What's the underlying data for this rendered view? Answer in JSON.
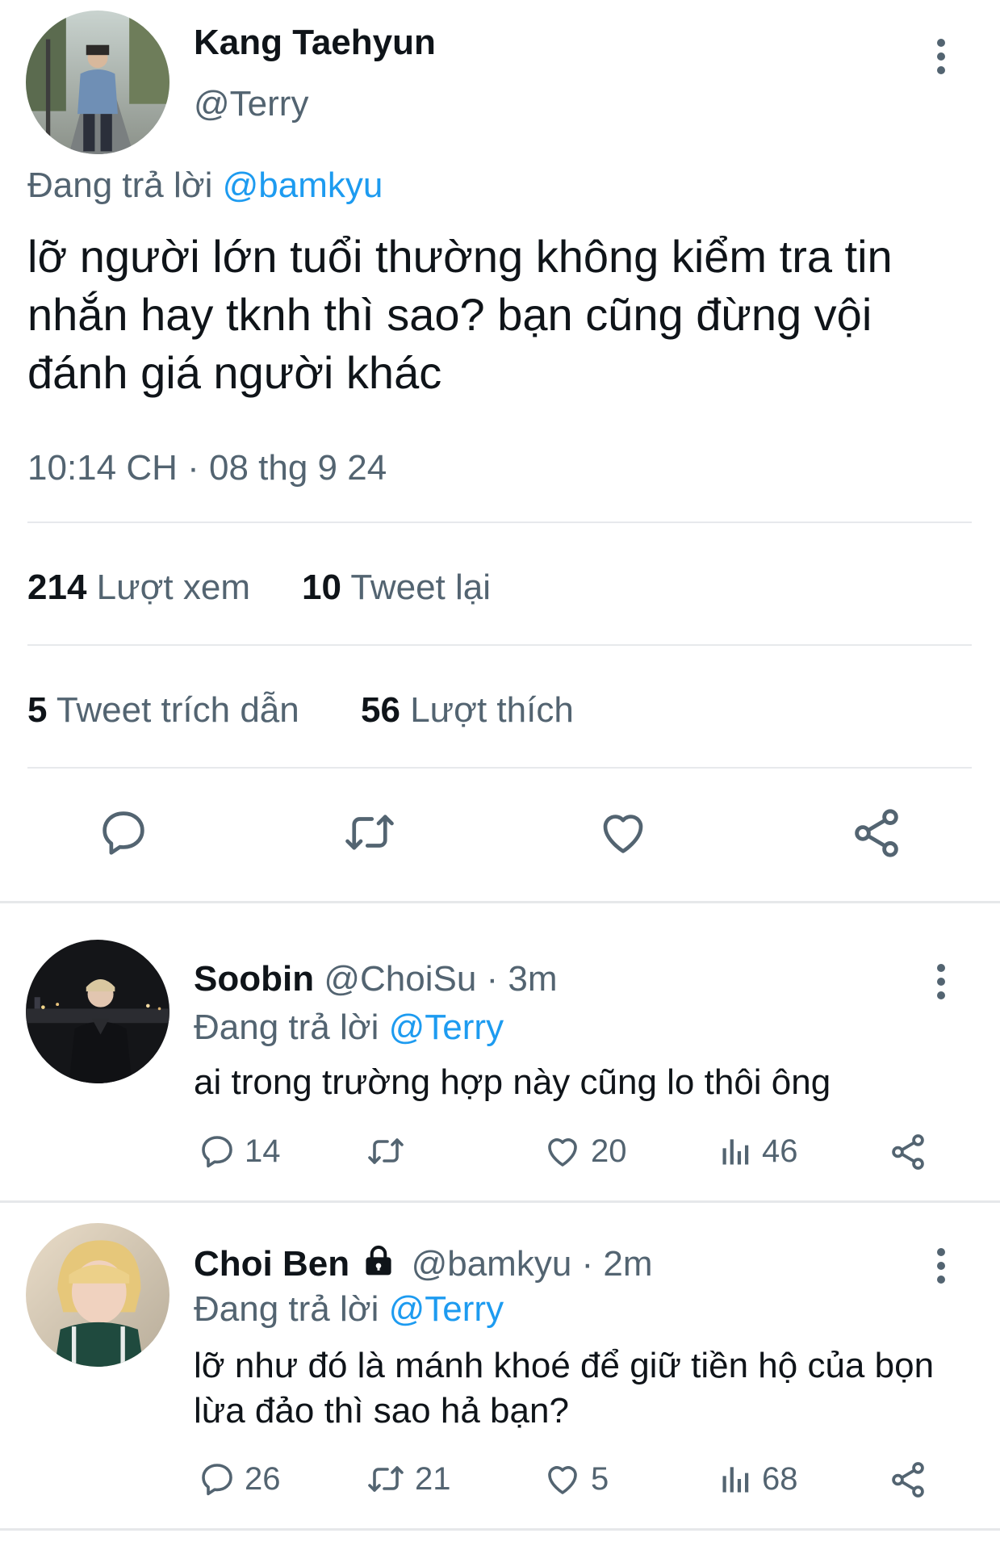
{
  "main_tweet": {
    "author_name": "Kang Taehyun",
    "author_handle": "@Terry",
    "replying_prefix": "Đang trả lời ",
    "replying_to": "@bamkyu",
    "text": "lỡ người lớn tuổi thường không kiểm tra tin\nnhắn hay tknh thì sao? bạn cũng đừng vội\nđánh giá người khác",
    "timestamp": "10:14 CH · 08 thg 9 24",
    "stats": {
      "views_count": "214",
      "views_label": "Lượt xem",
      "retweets_count": "10",
      "retweets_label": "Tweet lại",
      "quotes_count": "5",
      "quotes_label": "Tweet trích dẫn",
      "likes_count": "56",
      "likes_label": "Lượt thích"
    },
    "actions": [
      "reply-icon",
      "retweet-icon",
      "like-icon",
      "share-icon"
    ]
  },
  "replies": [
    {
      "name": "Soobin",
      "handle": "@ChoiSu",
      "time": " · 3m",
      "replying_prefix": "Đang trả lời ",
      "replying_to": "@Terry",
      "text": "ai trong trường hợp này cũng lo thôi ông",
      "locked": false,
      "counts": {
        "replies": "14",
        "retweets": "",
        "likes": "20",
        "views": "46"
      }
    },
    {
      "name": "Choi Ben",
      "handle": "@bamkyu",
      "time": " · 2m",
      "replying_prefix": "Đang trả lời ",
      "replying_to": "@Terry",
      "text": "lỡ như đó là mánh khoé để giữ tiền hộ của bọn lừa đảo thì sao hả bạn?",
      "locked": true,
      "counts": {
        "replies": "26",
        "retweets": "21",
        "likes": "5",
        "views": "68"
      }
    }
  ],
  "colors": {
    "text": "#0f1419",
    "muted": "#536471",
    "link": "#1d9bf0",
    "divider": "#e7e9ec"
  }
}
